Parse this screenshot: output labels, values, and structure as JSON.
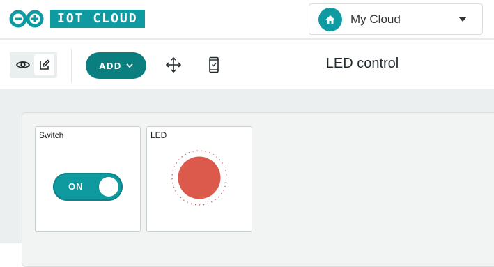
{
  "header": {
    "logo_text": "IOT CLOUD",
    "cloud_selector": {
      "label": "My Cloud",
      "icon": "home-icon"
    }
  },
  "toolbar": {
    "view_mode_icon": "eye-icon",
    "edit_mode_icon": "pencil-icon",
    "add_label": "ADD",
    "arrange_icon": "move-arrows-icon",
    "mobile_icon": "mobile-phone-icon",
    "dashboard_title": "LED control"
  },
  "widgets": [
    {
      "title": "Switch",
      "type": "switch",
      "state_label": "ON",
      "state": true
    },
    {
      "title": "LED",
      "type": "led",
      "state": true
    }
  ],
  "colors": {
    "brand_teal": "#0e9aa0",
    "add_button": "#0b7f7f",
    "led_on": "#dc5a4b",
    "canvas_bg": "#ecefef"
  }
}
